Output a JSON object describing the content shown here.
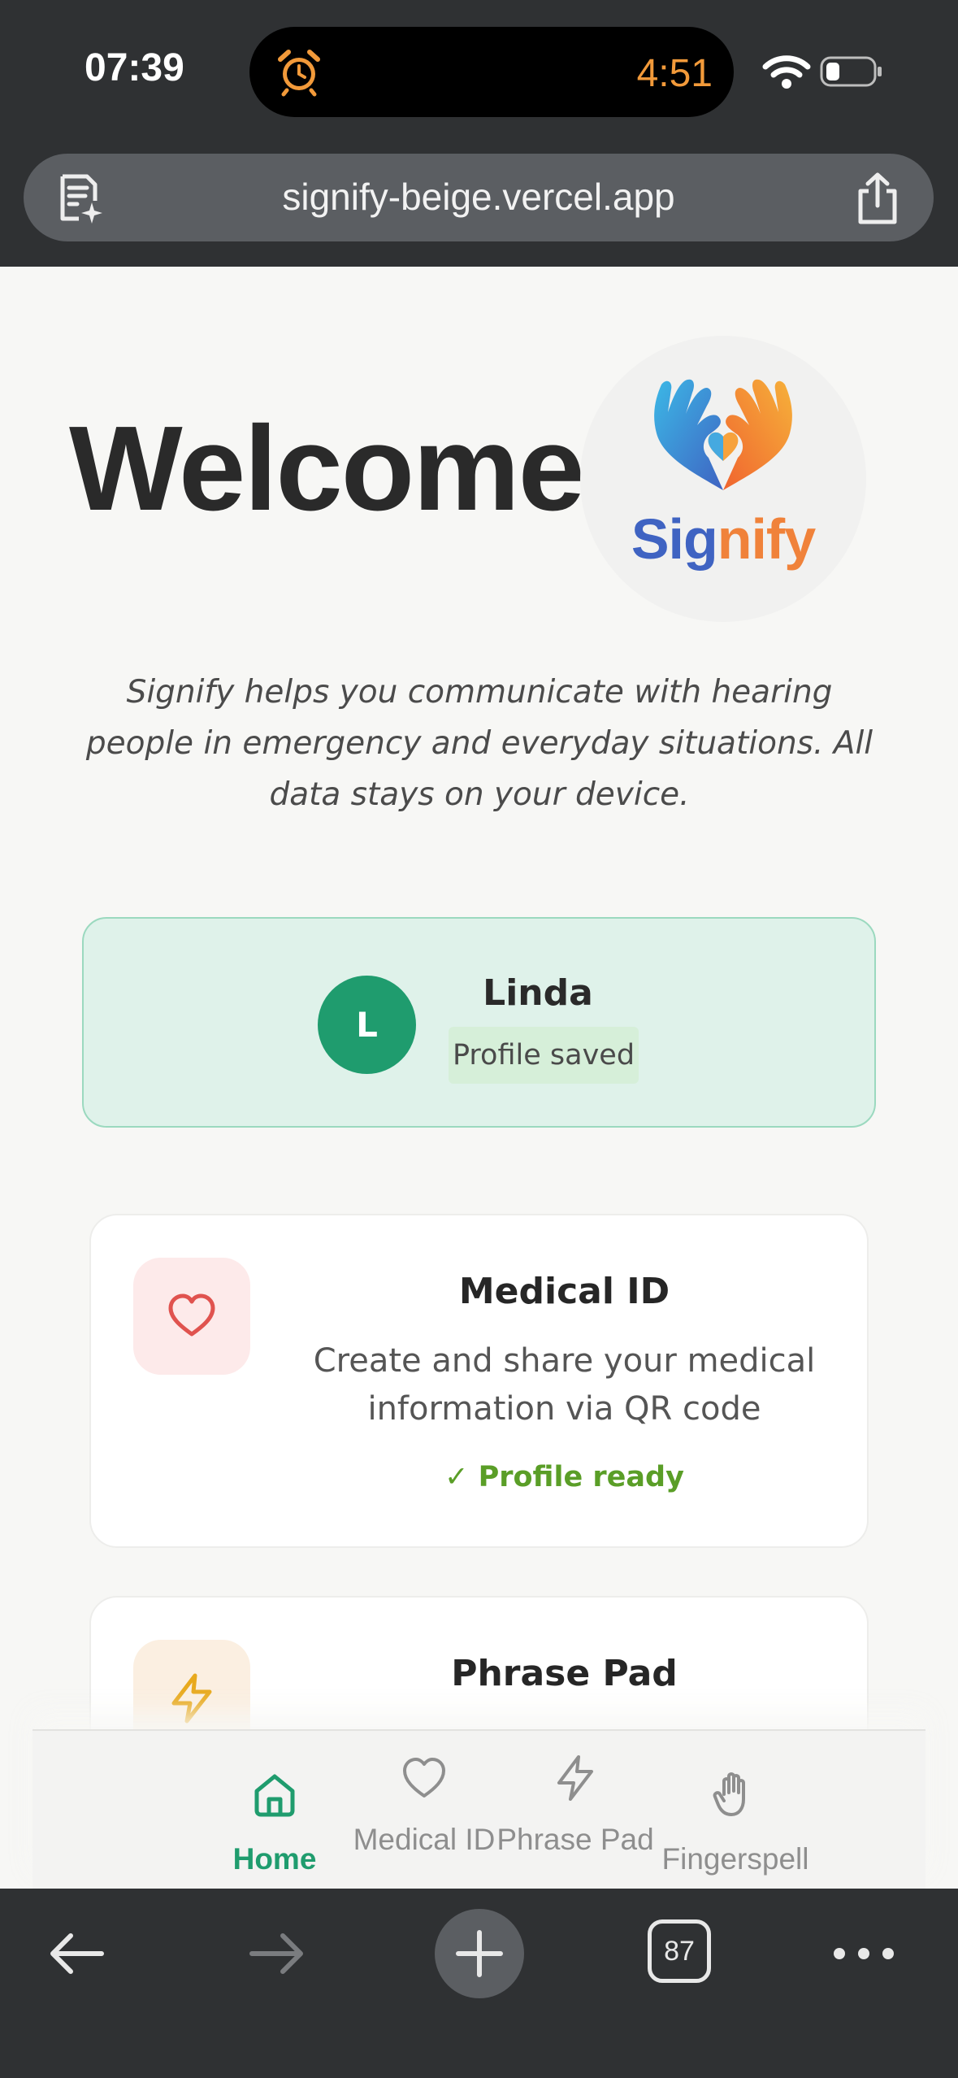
{
  "status_bar": {
    "time": "07:39",
    "timer": "4:51"
  },
  "browser": {
    "url": "signify-beige.vercel.app",
    "tab_count": "87"
  },
  "hero": {
    "title": "Welcome",
    "logo_part1": "Sig",
    "logo_part2": "nify",
    "intro": "Signify helps you communicate with hearing people in emergency and everyday situations. All data stays on your device."
  },
  "profile": {
    "initial": "L",
    "name": "Linda",
    "status": "Profile saved"
  },
  "cards": {
    "medical": {
      "title": "Medical ID",
      "description": "Create and share your medical information via QR code",
      "status": "✓ Profile ready"
    },
    "phrase": {
      "title": "Phrase Pad"
    }
  },
  "nav": {
    "home": "Home",
    "medical": "Medical ID",
    "phrase": "Phrase Pad",
    "fingerspell": "Fingerspell"
  },
  "colors": {
    "accent_green": "#1f9c6e",
    "ready_green": "#5a9e27",
    "heart_red": "#e0534f",
    "bolt_amber": "#e8a91c",
    "logo_blue": "#3f63c2",
    "logo_orange": "#f0823a"
  },
  "icons": {
    "reader": "reader-icon",
    "share": "share-icon",
    "alarm": "alarm-icon",
    "heart": "heart-icon",
    "bolt": "lightning-icon",
    "home": "home-icon",
    "hand": "hand-icon"
  }
}
